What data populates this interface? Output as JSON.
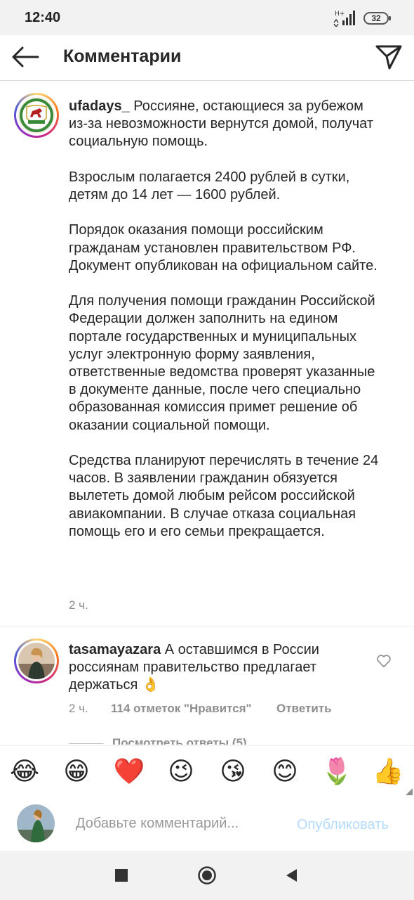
{
  "status_bar": {
    "time": "12:40",
    "network": "H+",
    "battery": "32"
  },
  "header": {
    "title": "Комментарии"
  },
  "post": {
    "username": "ufadays_",
    "paragraphs": [
      " Россияне, остающиеся за рубежом из-за невозможности вернутся домой, получат социальную помощь.",
      "Взрослым полагается 2400 рублей в сутки, детям до 14 лет — 1600 рублей.",
      "Порядок оказания помощи российским гражданам установлен правительством РФ. Документ опубликован на официальном сайте.",
      "Для получения помощи гражданин Российской Федерации должен заполнить на едином портале государственных и муниципальных услуг электронную форму заявления, ответственные ведомства проверят указанные в документе данные, после чего специально образованная комиссия примет решение об оказании социальной помощи.",
      "Средства планируют перечислять в течение 24 часов. В заявлении гражданин обязуется вылететь домой любым рейсом российской авиакомпании. В случае отказа социальная помощь его и его семьи прекращается."
    ],
    "time": "2 ч."
  },
  "comment": {
    "username": "tasamayazara",
    "text": " А оставшимся в России россиянам правительство предлагает держаться 👌",
    "time": "2 ч.",
    "likes": "114 отметок \"Нравится\"",
    "reply": "Ответить",
    "view_replies": "Посмотреть ответы (5)"
  },
  "emoji_bar": [
    "😂",
    "😁",
    "❤️",
    "😉",
    "😘",
    "😊",
    "🌷",
    "👍"
  ],
  "input": {
    "placeholder": "Добавьте комментарий...",
    "publish": "Опубликовать"
  },
  "colors": {
    "link_disabled": "#b3dbff",
    "secondary_text": "#8e8e8e",
    "primary_text": "#262626"
  }
}
